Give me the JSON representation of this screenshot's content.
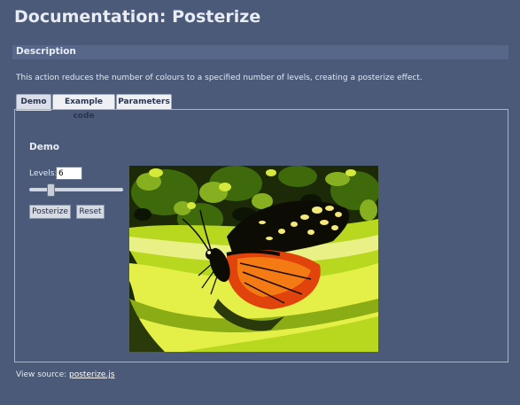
{
  "page": {
    "title": "Documentation: Posterize"
  },
  "description_section": {
    "heading": "Description",
    "text": "This action reduces the number of colours to a specified number of levels, creating a posterize effect."
  },
  "tabs": [
    {
      "label": "Demo",
      "active": true
    },
    {
      "label": "Example code",
      "active": false
    },
    {
      "label": "Parameters",
      "active": false
    }
  ],
  "demo": {
    "heading": "Demo",
    "levels_label": "Levels:",
    "levels_value": "6",
    "slider_fraction": 0.23,
    "posterize_label": "Posterize",
    "reset_label": "Reset",
    "image_subject": "posterized-butterfly"
  },
  "footer": {
    "prefix": "View source:",
    "link_text": "posterize.js"
  },
  "colors": {
    "background": "#4a5a78",
    "section_bar": "#56678a",
    "panel_border": "#a8b4cc"
  }
}
